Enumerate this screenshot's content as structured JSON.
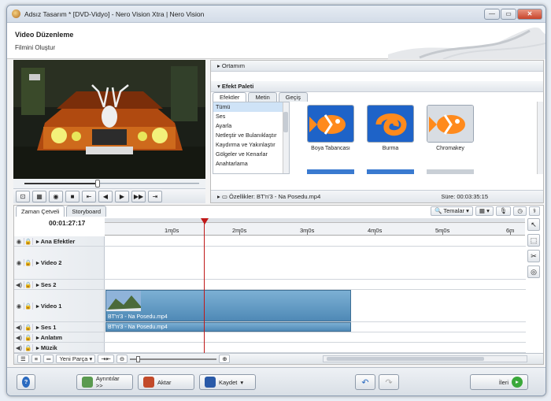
{
  "window": {
    "title": "Adsız Tasarım * [DVD-Vidyo] - Nero Vision Xtra | Nero Vision",
    "min": "—",
    "max": "▭",
    "close": "✕"
  },
  "header": {
    "title": "Video Düzenleme",
    "subtitle": "Filmini Oluştur"
  },
  "transport": {
    "buttons": [
      "⊡",
      "▦",
      "◉",
      "■",
      "⇤",
      "◀",
      "▶",
      "▶▶",
      "⇥"
    ]
  },
  "right_panel": {
    "ortam": "Ortamım",
    "palette": "Efekt Paleti",
    "tabs": [
      "Efektler",
      "Metin",
      "Geçiş"
    ],
    "list": [
      "Tümü",
      "Ses",
      "Ayarla",
      "Netleştir ve Bulanıklaştır",
      "Kaydırma ve Yakınlaştır",
      "Gölgeler ve Kenarlar",
      "Anahtarlama"
    ],
    "thumbs": [
      "Boya Tabancası",
      "Burma",
      "Chromakey"
    ],
    "props_label": "Özellikler: BT'n'3 - Na Posedu.mp4",
    "duration": "Süre: 00:03:35:15"
  },
  "timeline": {
    "tabs": [
      "Zaman Çetveli",
      "Storyboard"
    ],
    "temalar": "Temalar",
    "timecode": "00:01:27:17",
    "ruler": [
      "1m0s",
      "2m0s",
      "3m0s",
      "4m0s",
      "5m0s",
      "6m"
    ],
    "tracks": [
      "Ana Efektler",
      "Video 2",
      "Ses 2",
      "Video 1",
      "Ses 1",
      "Anlatım",
      "Müzik"
    ],
    "clip_video": "BT'n'3 - Na Posedu.mp4",
    "clip_audio": "BT'n'3 - Na Posedu.mp4",
    "new_part": "Yeni Parça"
  },
  "footer": {
    "help": "?",
    "details": "Ayrıntılar >>",
    "export": "Aktar",
    "save": "Kaydet",
    "next": "İleri"
  }
}
